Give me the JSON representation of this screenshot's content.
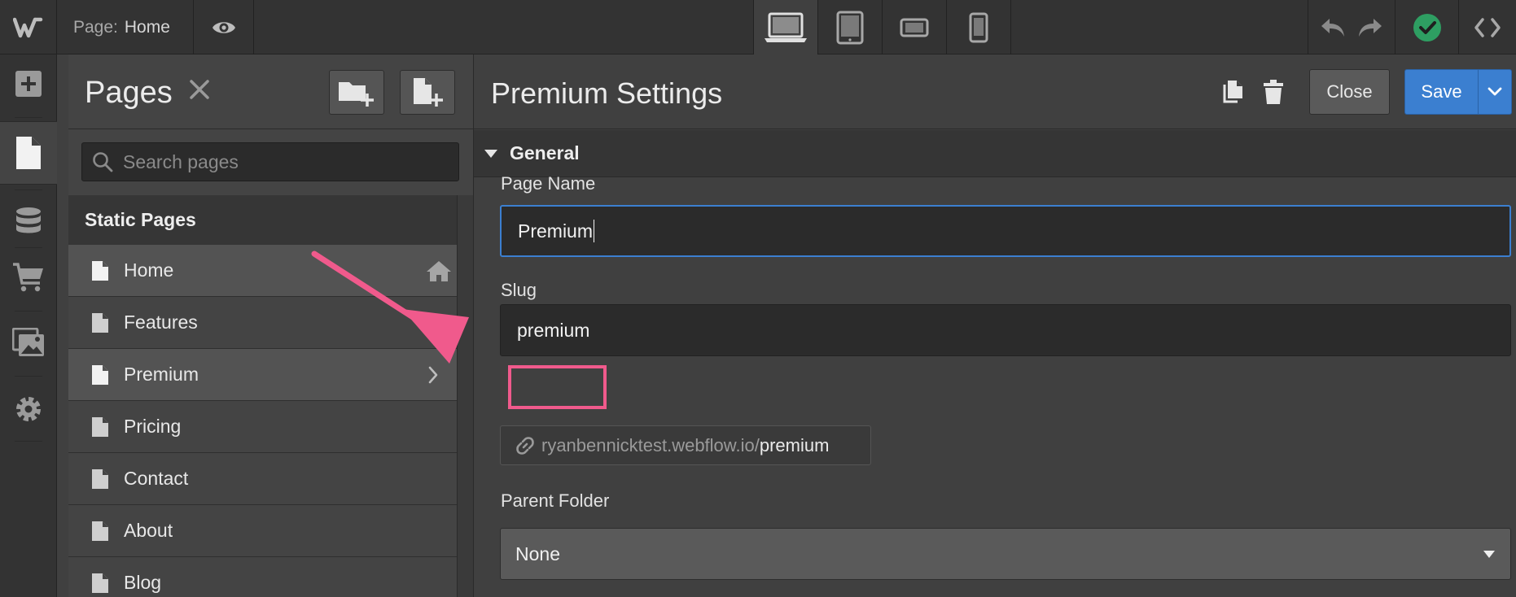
{
  "topbar": {
    "page_key": "Page:",
    "page_value": "Home"
  },
  "pages_panel": {
    "title": "Pages",
    "search_placeholder": "Search pages",
    "section_title": "Static Pages",
    "items": [
      {
        "label": "Home"
      },
      {
        "label": "Features"
      },
      {
        "label": "Premium"
      },
      {
        "label": "Pricing"
      },
      {
        "label": "Contact"
      },
      {
        "label": "About"
      },
      {
        "label": "Blog"
      }
    ]
  },
  "settings": {
    "title": "Premium Settings",
    "close_label": "Close",
    "save_label": "Save",
    "section": "General",
    "page_name_label": "Page Name",
    "page_name_value": "Premium",
    "slug_label": "Slug",
    "slug_value": "premium",
    "url_base": "ryanbennicktest.webflow.io/",
    "url_slug": "premium",
    "parent_folder_label": "Parent Folder",
    "parent_folder_value": "None"
  },
  "colors": {
    "accent": "#3b7fd0",
    "highlight": "#f05a8c",
    "status_ok": "#2e9e62"
  }
}
